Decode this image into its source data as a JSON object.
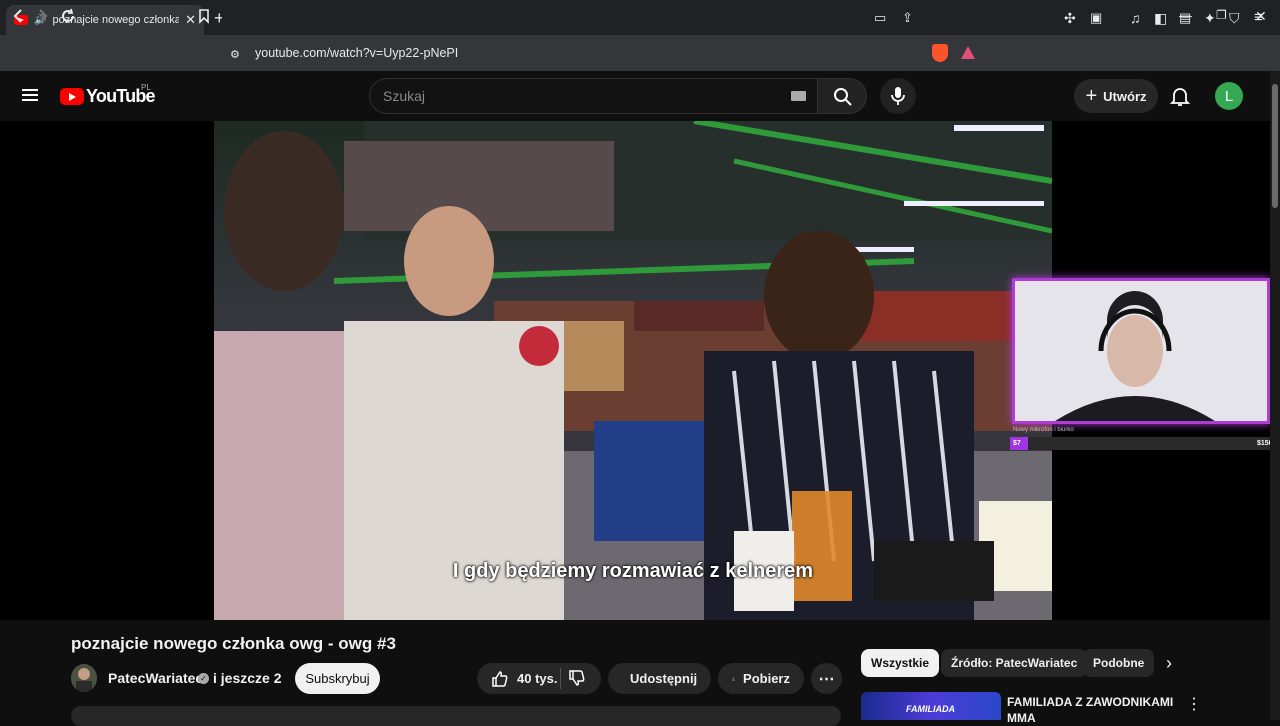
{
  "browser": {
    "tab_title": "poznajcie nowego członka ow",
    "url": "youtube.com/watch?v=Uyp22-pNePI"
  },
  "header": {
    "logo_text": "YouTube",
    "region": "PL",
    "search_placeholder": "Szukaj",
    "create_label": "Utwórz",
    "avatar_letter": "L"
  },
  "video": {
    "subtitle": "I gdy będziemy rozmawiać z kelnerem",
    "overlay": {
      "goal_label": "Nowy mikrofon i biurko",
      "goal_current": "$7",
      "goal_target": "$150"
    }
  },
  "info": {
    "title": "poznajcie nowego członka owg - owg #3",
    "channel": "PatecWariatec",
    "collaborators": "i jeszcze 2",
    "subscribe_label": "Subskrybuj",
    "likes": "40 tys.",
    "share_label": "Udostępnij",
    "download_label": "Pobierz"
  },
  "sidebar": {
    "chips": [
      "Wszystkie",
      "Źródło: PatecWariatec",
      "Podobne"
    ],
    "recommendation": {
      "title": "FAMILIADA Z ZAWODNIKAMI MMA",
      "thumb_text": "FAMILIADA"
    }
  },
  "colors": {
    "youtube_red": "#ff0000",
    "overlay_accent": "#b03cd8",
    "avatar_green": "#34a853"
  }
}
